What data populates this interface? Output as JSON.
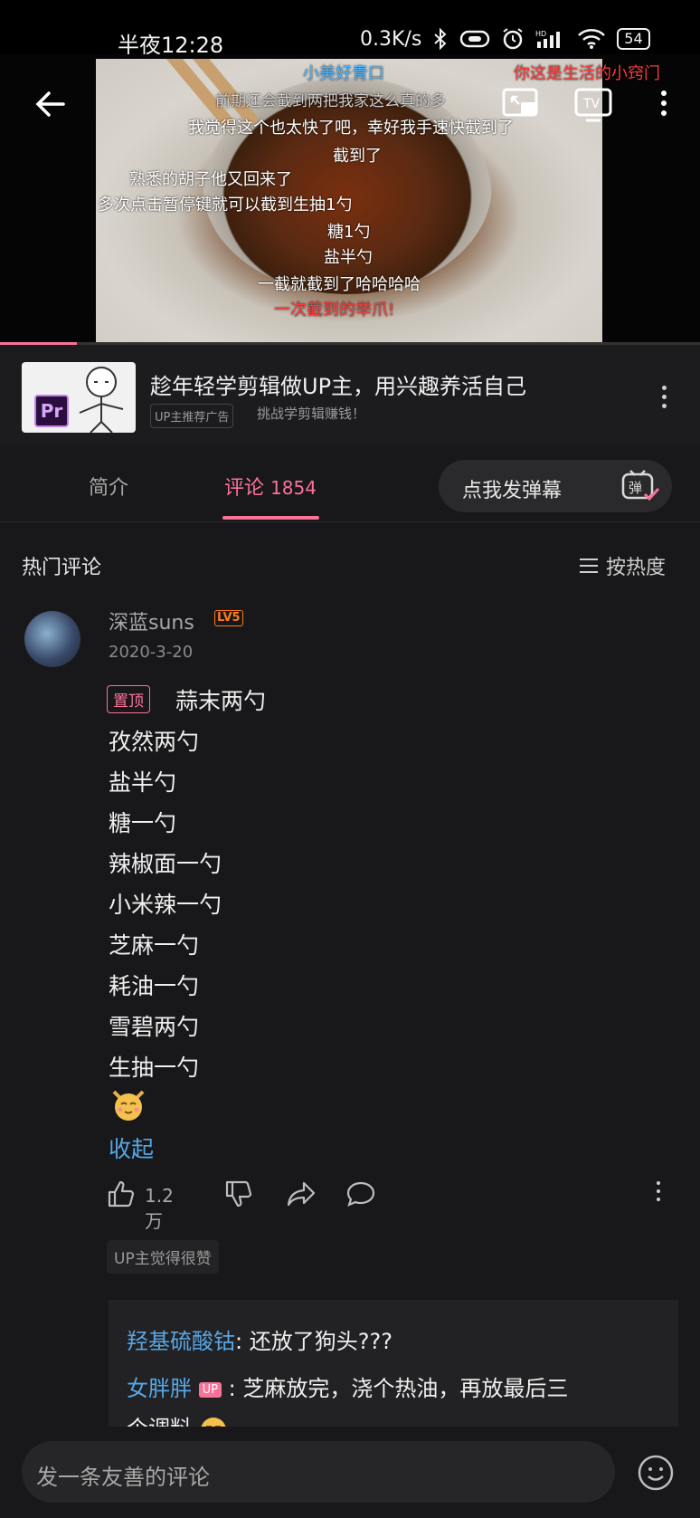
{
  "status_bar": {
    "time": "半夜12:28",
    "network_speed": "0.3K/s",
    "battery": "54",
    "icons": [
      "bluetooth-icon",
      "link-icon",
      "alarm-icon",
      "hd-signal-icon",
      "wifi-icon",
      "battery-icon"
    ]
  },
  "video": {
    "danmaku": [
      {
        "text": "小美好青口",
        "color": "#4fb6ff"
      },
      {
        "text": "你这是生活的小窍门",
        "color": "#ff3b3b"
      },
      {
        "text": "前期还会截到两把我家这么真的多",
        "color": "#cfcfcf"
      },
      {
        "text": "我觉得这个也太快了吧，幸好我手速快截到了",
        "color": "#ffffff"
      },
      {
        "text": "截到了",
        "color": "#ffffff"
      },
      {
        "text": "熟悉的胡子他又回来了",
        "color": "#ffffff"
      },
      {
        "text": "多次点击暂停键就可以截到生抽1勺",
        "color": "#ffffff"
      },
      {
        "text": "糖1勺",
        "color": "#ffffff"
      },
      {
        "text": "盐半勺",
        "color": "#ffffff"
      },
      {
        "text": "一截就截到了哈哈哈哈",
        "color": "#ffffff"
      },
      {
        "text": "一次截到的举爪!",
        "color": "#ff3b3b"
      }
    ],
    "progress_percent": 11
  },
  "ad": {
    "title": "趁年轻学剪辑做UP主，用兴趣养活自己",
    "tag": "UP主推荐广告",
    "subtitle": "挑战学剪辑赚钱！",
    "logo_text": "Pr"
  },
  "tabs": {
    "intro": "简介",
    "comments": "评论",
    "comment_count": "1854",
    "danmu_placeholder": "点我发弹幕",
    "danmu_icon_text": "弹"
  },
  "comments": {
    "section_title": "热门评论",
    "sort_label": "按热度",
    "top": {
      "username": "深蓝suns",
      "level": "LV5",
      "date": "2020-3-20",
      "pin_label": "置顶",
      "lines": [
        "蒜末两勺",
        "孜然两勺",
        "盐半勺",
        "糖一勺",
        "辣椒面一勺",
        "小米辣一勺",
        "芝麻一勺",
        "耗油一勺",
        "雪碧两勺",
        "生抽一勺"
      ],
      "collapse_label": "收起",
      "like_count": "1.2万",
      "up_liked": "UP主觉得很赞"
    },
    "replies": [
      {
        "name": "羟基硫酸钴",
        "text": ": 还放了狗头???",
        "up": false
      },
      {
        "name": "女胖胖",
        "badge": "UP",
        "text": " : 芝麻放完，浇个热油，再放最后三",
        "up": true
      },
      {
        "name": "",
        "text": "个调料",
        "up": false
      }
    ]
  },
  "bottom": {
    "input_placeholder": "发一条友善的评论"
  }
}
